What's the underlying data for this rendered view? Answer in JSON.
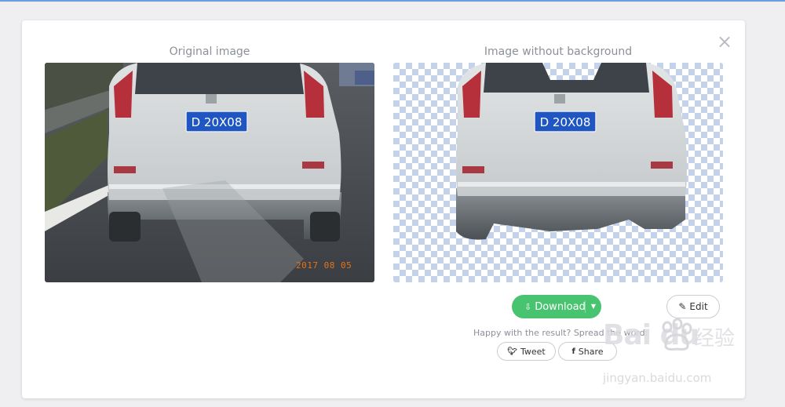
{
  "modal": {
    "close_label": "×",
    "original_caption": "Original image",
    "result_caption": "Image without background",
    "photo_stamp": "2017 08 05",
    "plate_text": "D 20X08",
    "download": {
      "label": "Download",
      "icon": "download-tray-icon",
      "accent": "#48c36f"
    },
    "edit": {
      "label": "Edit",
      "icon": "brush-icon"
    },
    "spread_text": "Happy with the result? Spread the word:",
    "tweet": {
      "label": "Tweet",
      "icon": "twitter-bird-icon"
    },
    "share": {
      "label": "Share",
      "icon": "facebook-f-icon"
    }
  },
  "watermark": {
    "brand": "Bai  du",
    "chinese": "经验",
    "url": "jingyan.baidu.com"
  }
}
